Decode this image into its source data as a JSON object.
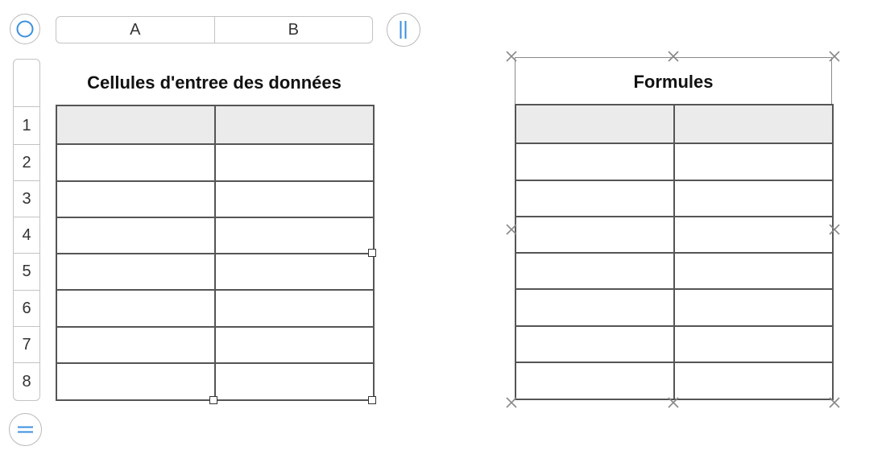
{
  "controls": {
    "select_all_icon": "circle-icon",
    "add_column_icon": "double-bar-icon",
    "add_row_icon": "double-line-icon",
    "accent_color": "#3a8fe0"
  },
  "column_headers": [
    "A",
    "B"
  ],
  "row_headers": [
    "1",
    "2",
    "3",
    "4",
    "5",
    "6",
    "7",
    "8"
  ],
  "table_left": {
    "title": "Cellules d'entree des données",
    "columns": 2,
    "rows": 8,
    "header_rows": 1,
    "selected": true
  },
  "table_right": {
    "title": "Formules",
    "columns": 2,
    "rows": 8,
    "header_rows": 1,
    "selected": true
  }
}
